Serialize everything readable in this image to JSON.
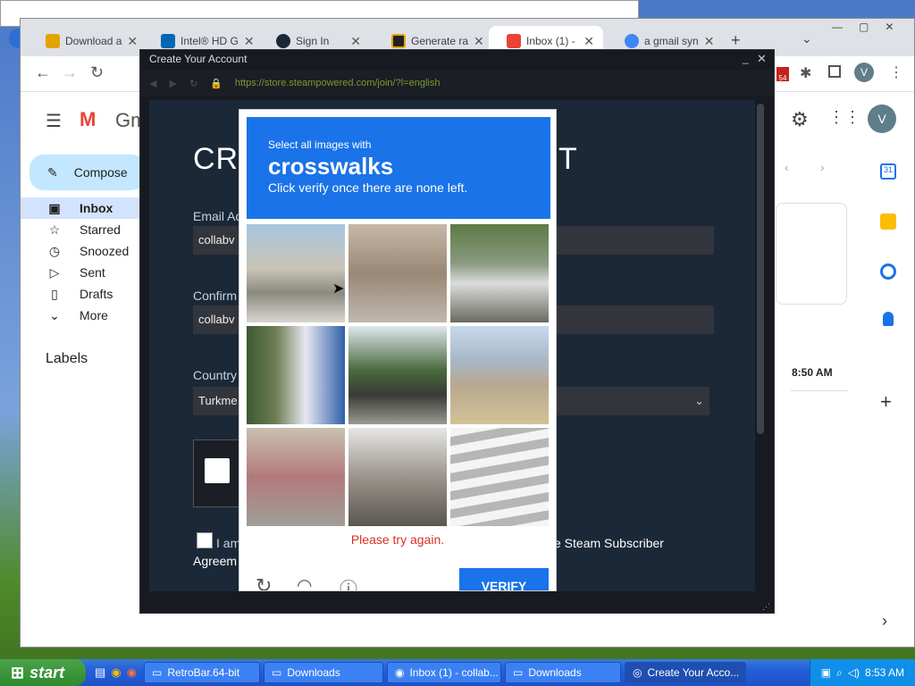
{
  "chrome": {
    "tabs": [
      {
        "label": "Download a",
        "color": "#e2a400"
      },
      {
        "label": "Intel® HD G",
        "color": "#0068b5"
      },
      {
        "label": "Sign In",
        "color": "#1b2838"
      },
      {
        "label": "Generate ra",
        "color": "#222222"
      },
      {
        "label": "Inbox (1) - ",
        "color": "#ea4335"
      },
      {
        "label": "a gmail syn",
        "color": "#4285f4"
      }
    ],
    "new_tab": "+",
    "profile_initial": "V",
    "ext_badge": "54"
  },
  "gmail": {
    "logo": "Gm",
    "compose": "Compose",
    "nav": [
      {
        "label": "Inbox",
        "icon": "inbox-icon"
      },
      {
        "label": "Starred",
        "icon": "star-icon"
      },
      {
        "label": "Snoozed",
        "icon": "clock-icon"
      },
      {
        "label": "Sent",
        "icon": "send-icon"
      },
      {
        "label": "Drafts",
        "icon": "draft-icon"
      },
      {
        "label": "More",
        "icon": "chevron-down-icon"
      }
    ],
    "labels_heading": "Labels",
    "time": "8:50 AM"
  },
  "steam": {
    "window_title": "Create Your Account",
    "url": "https://store.steampowered.com/join/?l=english",
    "heading_left": "CRE",
    "heading_right": "T",
    "email_label": "Email Ad",
    "email_value": "collabv",
    "confirm_label": "Confirm",
    "confirm_value": "collabv",
    "country_label": "Country",
    "country_value": "Turkme",
    "agree_left": "I am",
    "agree_right": "e Steam Subscriber",
    "agree_line2": "Agreem"
  },
  "captcha": {
    "instruction": "Select all images with",
    "keyword": "crosswalks",
    "subtext": "Click verify once there are none left.",
    "error": "Please try again.",
    "verify": "VERIFY"
  },
  "taskbar": {
    "start": "start",
    "items": [
      {
        "label": "RetroBar.64-bit",
        "active": false
      },
      {
        "label": "Downloads",
        "active": false
      },
      {
        "label": "Inbox (1) - collab...",
        "active": false
      },
      {
        "label": "Downloads",
        "active": false
      },
      {
        "label": "Create Your Acco...",
        "active": true
      }
    ],
    "clock": "8:53 AM"
  }
}
